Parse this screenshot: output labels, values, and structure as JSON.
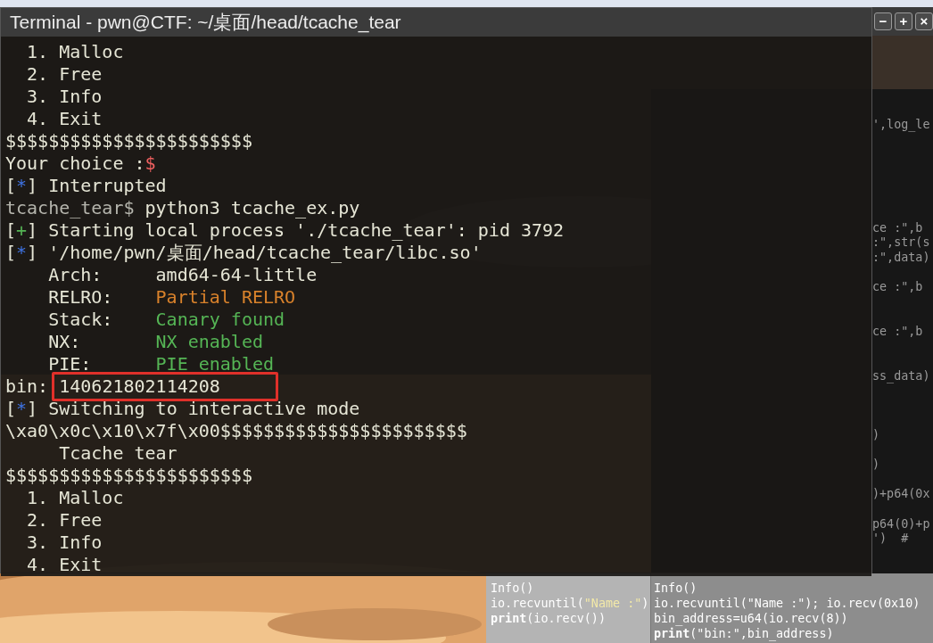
{
  "terminal": {
    "title": "Terminal - pwn@CTF: ~/桌面/head/tcache_tear",
    "lines": [
      [
        {
          "text": "  1. Malloc",
          "kind": "plain"
        }
      ],
      [
        {
          "text": "  2. Free",
          "kind": "plain"
        }
      ],
      [
        {
          "text": "  3. Info",
          "kind": "plain"
        }
      ],
      [
        {
          "text": "  4. Exit",
          "kind": "plain"
        }
      ],
      [
        {
          "text": "$$$$$$$$$$$$$$$$$$$$$$$",
          "kind": "plain"
        }
      ],
      [
        {
          "text": "Your choice :",
          "kind": "plain"
        },
        {
          "text": "$",
          "kind": "red"
        }
      ],
      [
        {
          "text": "[",
          "kind": "plain"
        },
        {
          "text": "*",
          "kind": "blue"
        },
        {
          "text": "] Interrupted",
          "kind": "plain"
        }
      ],
      [
        {
          "text": "tcache_tear$",
          "kind": "prompt"
        },
        {
          "text": " python3 tcache_ex.py",
          "kind": "plain"
        }
      ],
      [
        {
          "text": "[",
          "kind": "plain"
        },
        {
          "text": "+",
          "kind": "green"
        },
        {
          "text": "] Starting local process './tcache_tear': pid 3792",
          "kind": "plain"
        }
      ],
      [
        {
          "text": "[",
          "kind": "plain"
        },
        {
          "text": "*",
          "kind": "blue"
        },
        {
          "text": "] '/home/pwn/桌面/head/tcache_tear/libc.so'",
          "kind": "plain"
        }
      ],
      [
        {
          "text": "    Arch:     amd64-64-little",
          "kind": "plain"
        }
      ],
      [
        {
          "text": "    RELRO:    ",
          "kind": "plain"
        },
        {
          "text": "Partial RELRO",
          "kind": "orange"
        }
      ],
      [
        {
          "text": "    Stack:    ",
          "kind": "plain"
        },
        {
          "text": "Canary found",
          "kind": "green"
        }
      ],
      [
        {
          "text": "    NX:       ",
          "kind": "plain"
        },
        {
          "text": "NX enabled",
          "kind": "green"
        }
      ],
      [
        {
          "text": "    PIE:      ",
          "kind": "plain"
        },
        {
          "text": "PIE enabled",
          "kind": "green"
        }
      ],
      [
        {
          "text": "bin: ",
          "kind": "plain"
        },
        {
          "text": "140621802114208",
          "kind": "boxed"
        }
      ],
      [
        {
          "text": "[",
          "kind": "plain"
        },
        {
          "text": "*",
          "kind": "blue"
        },
        {
          "text": "] Switching to interactive mode",
          "kind": "plain"
        }
      ],
      [
        {
          "text": "\\xa0\\x0c\\x10\\x7f\\x00$$$$$$$$$$$$$$$$$$$$$$$",
          "kind": "plain"
        }
      ],
      [
        {
          "text": "     Tcache tear",
          "kind": "plain"
        }
      ],
      [
        {
          "text": "$$$$$$$$$$$$$$$$$$$$$$$",
          "kind": "plain"
        }
      ],
      [
        {
          "text": "  1. Malloc",
          "kind": "plain"
        }
      ],
      [
        {
          "text": "  2. Free",
          "kind": "plain"
        }
      ],
      [
        {
          "text": "  3. Info",
          "kind": "plain"
        }
      ],
      [
        {
          "text": "  4. Exit",
          "kind": "plain"
        }
      ]
    ]
  },
  "editor": {
    "window_buttons": [
      "−",
      "+",
      "×"
    ],
    "lines": [
      {
        "kind": "blank"
      },
      {
        "kind": "code",
        "text": "',log_le"
      },
      {
        "kind": "blank"
      },
      {
        "kind": "blank"
      },
      {
        "kind": "blank"
      },
      {
        "kind": "blank"
      },
      {
        "kind": "blank"
      },
      {
        "kind": "blank"
      },
      {
        "kind": "code",
        "text": "ce :\",b"
      },
      {
        "kind": "code",
        "text": ":\",str(s"
      },
      {
        "kind": "code",
        "text": ":\",data)"
      },
      {
        "kind": "blank"
      },
      {
        "kind": "code",
        "text": "ce :\",b"
      },
      {
        "kind": "blank"
      },
      {
        "kind": "blank"
      },
      {
        "kind": "code",
        "text": "ce :\",b"
      },
      {
        "kind": "blank"
      },
      {
        "kind": "blank"
      },
      {
        "kind": "code",
        "text": "ss_data)"
      },
      {
        "kind": "blank"
      },
      {
        "kind": "blank"
      },
      {
        "kind": "blank"
      },
      {
        "kind": "code",
        "text": ")"
      },
      {
        "kind": "blank"
      },
      {
        "kind": "code",
        "text": ")"
      },
      {
        "kind": "blank"
      },
      {
        "kind": "code",
        "text": ")+p64(0x"
      },
      {
        "kind": "blank"
      },
      {
        "kind": "code",
        "text": "p64(0)+p"
      },
      {
        "kind": "code",
        "text": "')  #"
      }
    ],
    "lower_lines": [
      [
        {
          "text": "Info()",
          "kind": "plain"
        }
      ],
      [
        {
          "text": "io.recvuntil(\"Name :\"); io.recv(0x10)",
          "kind": "plain"
        }
      ],
      [
        {
          "text": "bin_address=u64(io.recv(8))",
          "kind": "plain"
        }
      ],
      [
        {
          "text": "print",
          "kind": "keyword"
        },
        {
          "text": "(\"bin:\",bin_address)",
          "kind": "plain"
        }
      ]
    ]
  },
  "second_editor": {
    "lines": [
      [
        {
          "text": "Info()",
          "kind": "plain"
        }
      ],
      [
        {
          "text": "io.recvuntil(",
          "kind": "plain"
        },
        {
          "text": "\"Name :\"",
          "kind": "string"
        },
        {
          "text": ")",
          "kind": "plain"
        }
      ],
      [
        {
          "text": "print",
          "kind": "keyword"
        },
        {
          "text": "(io.recv())",
          "kind": "plain"
        }
      ]
    ]
  }
}
